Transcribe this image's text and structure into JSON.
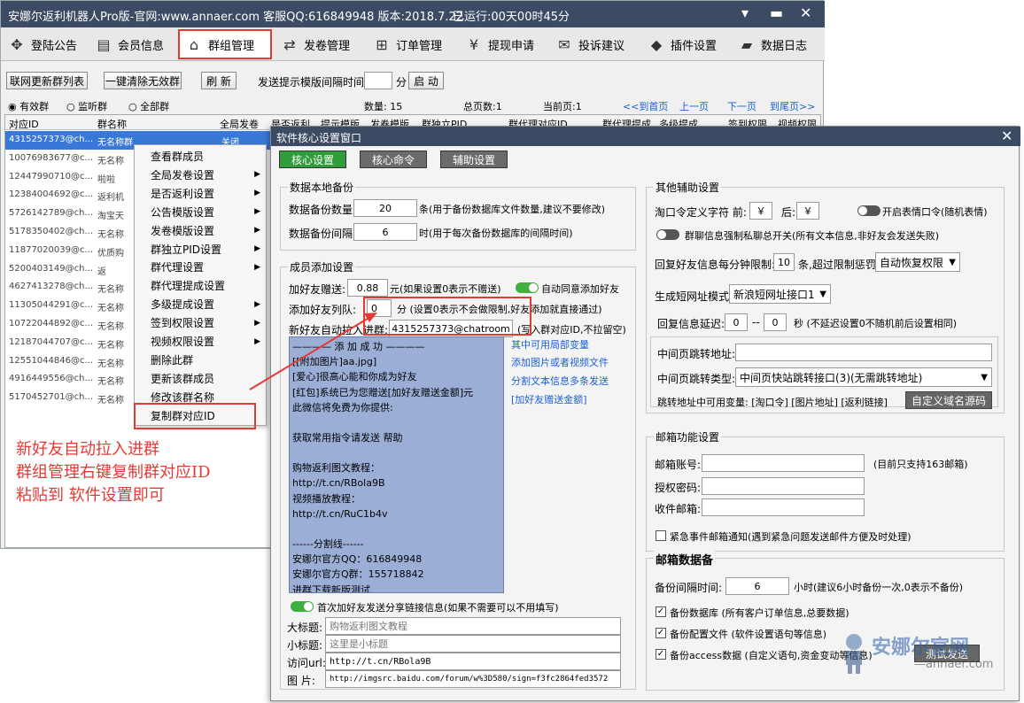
{
  "main": {
    "title": "安娜尔返利机器人Pro版-官网:www.annaer.com 客服QQ:616849948 版本:2018.7.22",
    "run_time": "已运行:00天00时45分",
    "nav": [
      {
        "label": "登陆公告",
        "icon": "crosshair-icon",
        "glyph": "✥"
      },
      {
        "label": "会员信息",
        "icon": "id-card-icon",
        "glyph": "▤"
      },
      {
        "label": "群组管理",
        "icon": "home-icon",
        "glyph": "⌂"
      },
      {
        "label": "发卷管理",
        "icon": "transfer-icon",
        "glyph": "⇄"
      },
      {
        "label": "订单管理",
        "icon": "cart-icon",
        "glyph": "⊞"
      },
      {
        "label": "提现申请",
        "icon": "yen-coin-icon",
        "glyph": "¥"
      },
      {
        "label": "投诉建议",
        "icon": "mail-icon",
        "glyph": "✉"
      },
      {
        "label": "插件设置",
        "icon": "cube-icon",
        "glyph": "◆"
      },
      {
        "label": "数据日志",
        "icon": "folder-icon",
        "glyph": "▰"
      }
    ],
    "toolbar": {
      "refresh_list": "联网更新群列表",
      "clear_invalid": "一键清除无效群",
      "refresh": "刷 新",
      "interval_label": "发送提示模版间隔时间:",
      "interval_value": "",
      "minute": "分",
      "start": "启 动"
    },
    "filters": {
      "valid": "有效群",
      "listen": "监听群",
      "all": "全部群"
    },
    "pager": {
      "count": "数量: 15",
      "pages": "总页数:1",
      "current": "当前页:1",
      "first": "<<到首页",
      "prev": "上一页",
      "next": "下一页",
      "last": "到尾页>>"
    },
    "columns": [
      "对应ID",
      "群名称",
      "全局发卷",
      "是否返利",
      "提示模版",
      "发卷模版",
      "群独立PID",
      "群代理对应ID",
      "群代理提成",
      "多级提成",
      "签到权限",
      "视频权限"
    ],
    "rows": [
      {
        "id": "4315257373@ch...",
        "name": "无名称群",
        "flag": "关闭"
      },
      {
        "id": "10076983677@c...",
        "name": "无名称"
      },
      {
        "id": "12447990710@c...",
        "name": "啦啦"
      },
      {
        "id": "12384004692@c...",
        "name": "返利机"
      },
      {
        "id": "5726142789@ch...",
        "name": "淘宝天"
      },
      {
        "id": "5178350402@ch...",
        "name": "无名称"
      },
      {
        "id": "11877020039@c...",
        "name": "优质购"
      },
      {
        "id": "5200403149@ch...",
        "name": "返"
      },
      {
        "id": "4627413278@ch...",
        "name": "无名称"
      },
      {
        "id": "11305044291@c...",
        "name": "无名称"
      },
      {
        "id": "10722044892@c...",
        "name": "无名称"
      },
      {
        "id": "12187044707@c...",
        "name": "无名称"
      },
      {
        "id": "12551044846@c...",
        "name": "无名称"
      },
      {
        "id": "4916449556@ch...",
        "name": "无名称"
      },
      {
        "id": "5170452701@ch...",
        "name": "无名称"
      }
    ],
    "context_menu": [
      {
        "label": "查看群成员",
        "sub": false
      },
      {
        "label": "全局发卷设置",
        "sub": true
      },
      {
        "label": "是否返利设置",
        "sub": true
      },
      {
        "label": "公告模版设置",
        "sub": true
      },
      {
        "label": "发卷模版设置",
        "sub": true
      },
      {
        "label": "群独立PID设置",
        "sub": true
      },
      {
        "label": "群代理设置",
        "sub": true
      },
      {
        "label": "群代理提成设置",
        "sub": false
      },
      {
        "label": "多级提成设置",
        "sub": true
      },
      {
        "label": "签到权限设置",
        "sub": true
      },
      {
        "label": "视频权限设置",
        "sub": true
      },
      {
        "label": "删除此群",
        "sub": false
      },
      {
        "label": "更新该群成员",
        "sub": false
      },
      {
        "label": "修改该群名称",
        "sub": false
      },
      {
        "label": "复制群对应ID",
        "sub": false
      }
    ]
  },
  "annotation": [
    "新好友自动拉入进群",
    "群组管理右键复制群对应ID",
    "粘贴到 软件设置即可"
  ],
  "settings": {
    "title": "软件核心设置窗口",
    "tabs": [
      "核心设置",
      "核心命令",
      "辅助设置"
    ],
    "backup": {
      "title": "数据本地备份",
      "count_label": "数据备份数量:",
      "count_value": "20",
      "count_hint": "条(用于备份数据库文件数量,建议不要修改)",
      "interval_label": "数据备份间隔:",
      "interval_value": "6",
      "interval_hint": "时(用于每次备份数据库的间隔时间)"
    },
    "member": {
      "title": "成员添加设置",
      "gift_label": "加好友赠送:",
      "gift_value": "0.88",
      "gift_hint": "元(如果设置0表示不赠送)",
      "auto_accept": "自动同意添加好友",
      "queue_label": "添加好友列队:",
      "queue_value": "0",
      "queue_hint": "分 (设置0表示不会做限制,好友添加就直接通过)",
      "autopull_label": "新好友自动拉入进群:",
      "autopull_value": "4315257373@chatroom",
      "autopull_hint": "(写入群对应ID,不拉留空)",
      "message_lines": [
        "———— 添 加 成 功 ————",
        "[[附加图片]aa.jpg]",
        "[爱心]很高心能和你成为好友",
        "[红包]系统已为您赠送[加好友赠送金额]元",
        "此微信将免费为你提供:",
        "",
        "获取常用指令请发送  帮助",
        "",
        "购物返利图文教程：",
        "http://t.cn/RBola9B",
        "视频播放教程：",
        "http://t.cn/RuC1b4v",
        "",
        "------分割线------",
        "安娜尔官方QQ：616849948",
        "安娜尔官方Q群：155718842",
        "进群下载新版测试",
        "代理拿货五折 进群联系群主"
      ],
      "side_links": [
        "其中可用局部变量",
        "添加图片或者视频文件",
        "分割文本信息多条发送",
        "[加好友赠送金额]"
      ],
      "share_toggle": "首次加好友发送分享链接信息(如果不需要可以不用填写)",
      "big_title_label": "大标题:",
      "big_title_value": "购物返利图文教程",
      "small_title_label": "小标题:",
      "small_title_value": "这里是小标题",
      "url_label": "访问url:",
      "url_value": "http://t.cn/RBola9B",
      "pic_label": "图   片:",
      "pic_value": "http://imgsrc.baidu.com/forum/w%3D580/sign=f3fc2864fed3572"
    },
    "other": {
      "title": "其他辅助设置",
      "tao_label": "淘口令定义字符 前:",
      "tao_before": "￥",
      "tao_after_label": "后:",
      "tao_after": "￥",
      "emoji_toggle": "开启表情口令(随机表情)",
      "private_toggle": "群聊信息强制私聊总开关(所有文本信息,非好友会发送失败)",
      "reply_label": "回复好友信息每分钟限制:",
      "reply_value": "10",
      "reply_hint": "条,超过限制惩罚",
      "reply_select": "自动恢复权限",
      "short_label": "生成短网址模式:",
      "short_select": "新浪短网址接口1",
      "delay_label": "回复信息延迟:",
      "delay_from": "0",
      "delay_sep": "--",
      "delay_to": "0",
      "delay_hint": "秒 (不延迟设置0不随机前后设置相同)",
      "mid_url_label": "中间页跳转地址:",
      "mid_type_label": "中间页跳转类型:",
      "mid_type_select": "中间页快站跳转接口(3)(无需跳转地址)",
      "vars_label": "跳转地址中可用变量: [淘口令] [图片地址] [返利链接]",
      "custom_btn": "自定义域名源码"
    },
    "mail": {
      "title": "邮箱功能设置",
      "account_label": "邮箱账号:",
      "account_hint": "(目前只支持163邮箱)",
      "auth_label": "授权密码:",
      "recv_label": "收件邮箱:",
      "urgent": "紧急事件邮箱通知(遇到紧急问题发送邮件方便及时处理)",
      "backup_title": "邮箱数据备",
      "backup_interval_label": "备份间隔时间:",
      "backup_interval_value": "6",
      "backup_interval_hint": "小时(建议6小时备份一次,0表示不备份)",
      "cb_db": "备份数据库  (所有客户订单信息,总要数据)",
      "cb_config": "备份配置文件  (软件设置语句等信息)",
      "cb_access": "备份access数据  (自定义语句,资金变动等信息)",
      "test_btn": "测试发送"
    },
    "watermark": {
      "cn": "安娜尔官网",
      "en": "—annaer.com"
    }
  },
  "colors": {
    "titlebar": "#3c4a63",
    "accent_red": "#e53935",
    "tab_green": "#2f9e3a",
    "tab_gray": "#6b6b6b",
    "msg_bg": "#9aaed6",
    "toggle_on": "#3fb03f"
  }
}
